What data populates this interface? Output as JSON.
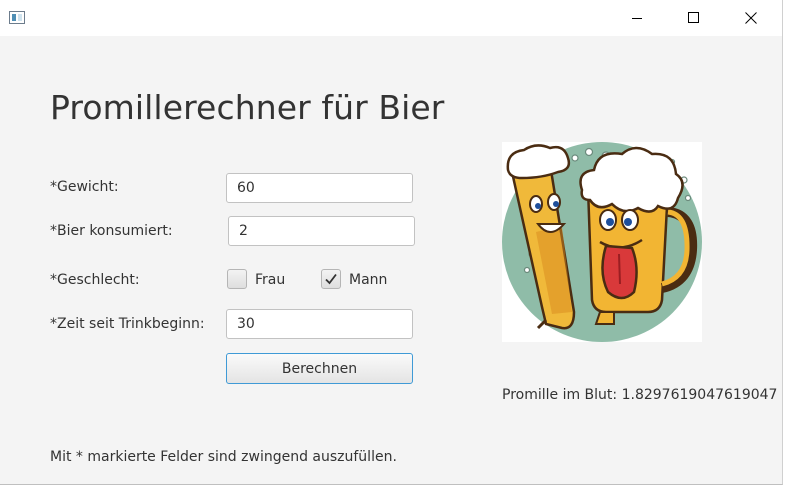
{
  "window": {
    "controls": {
      "minimize_icon": "minimize-icon",
      "maximize_icon": "maximize-icon",
      "close_icon": "close-icon"
    }
  },
  "heading": "Promillerechner für Bier",
  "form": {
    "weight": {
      "label": "*Gewicht:",
      "value": "60"
    },
    "beer": {
      "label": "*Bier konsumiert:",
      "value": "2"
    },
    "gender": {
      "label": "*Geschlecht:",
      "options": [
        {
          "label": "Frau",
          "checked": false
        },
        {
          "label": "Mann",
          "checked": true
        }
      ]
    },
    "time": {
      "label": "*Zeit seit Trinkbeginn:",
      "value": "30"
    },
    "calculate_label": "Berechnen"
  },
  "image": {
    "description_icon": "beer-mugs-illustration"
  },
  "result": "Promille im Blut: 1.8297619047619047",
  "footnote": "Mit * markierte Felder sind zwingend auszufüllen.",
  "colors": {
    "accent_border": "#3f9ad6",
    "background": "#f4f4f4",
    "text": "#333333",
    "illustration_circle": "#8fbca8"
  }
}
